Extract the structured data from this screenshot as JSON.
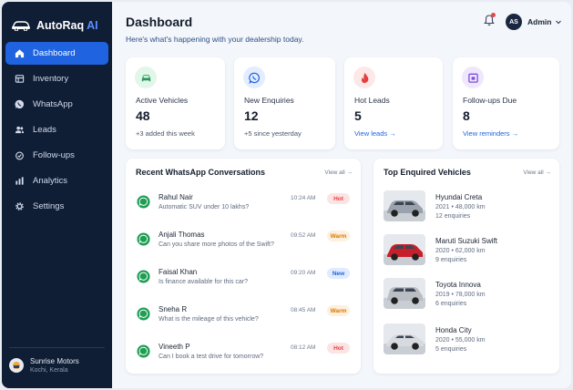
{
  "app": {
    "brand_prefix": "AutoRaq",
    "brand_suffix": "AI"
  },
  "sidebar": {
    "items": [
      {
        "label": "Dashboard",
        "icon": "home-icon",
        "active": true
      },
      {
        "label": "Inventory",
        "icon": "inventory-icon",
        "active": false
      },
      {
        "label": "WhatsApp",
        "icon": "whatsapp-icon",
        "active": false
      },
      {
        "label": "Leads",
        "icon": "users-icon",
        "active": false
      },
      {
        "label": "Follow-ups",
        "icon": "followup-icon",
        "active": false
      },
      {
        "label": "Analytics",
        "icon": "analytics-icon",
        "active": false
      },
      {
        "label": "Settings",
        "icon": "gear-icon",
        "active": false
      }
    ],
    "dealer": {
      "name": "Sunrise Motors",
      "location": "Kochi, Kerala"
    }
  },
  "header": {
    "title": "Dashboard",
    "subtitle": "Here's what's happening with your dealership today.",
    "user_initials": "AS",
    "user_name": "Admin"
  },
  "stats": [
    {
      "label": "Active Vehicles",
      "value": "48",
      "sub": "+3 added this week",
      "icon": "car-icon",
      "color": "#1f9d55",
      "bg": "#e3f6ea"
    },
    {
      "label": "New Enquiries",
      "value": "12",
      "sub": "+5 since yesterday",
      "icon": "whatsapp-icon",
      "color": "#1f63e0",
      "bg": "#e3edff"
    },
    {
      "label": "Hot Leads",
      "value": "5",
      "link": "View leads →",
      "icon": "flame-icon",
      "color": "#e53e3e",
      "bg": "#fde8e8"
    },
    {
      "label": "Follow-ups Due",
      "value": "8",
      "link": "View reminders →",
      "icon": "calendar-icon",
      "color": "#7c4ddb",
      "bg": "#efe7fc"
    }
  ],
  "conversations": {
    "title": "Recent WhatsApp Conversations",
    "view_all": "View all →",
    "items": [
      {
        "name": "Rahul Nair",
        "message": "Automatic SUV under 10 lakhs?",
        "time": "10:24 AM",
        "badge": "Hot",
        "badge_color": "#e53e3e",
        "badge_bg": "#fde4e4"
      },
      {
        "name": "Anjali Thomas",
        "message": "Can you share more photos of the Swift?",
        "time": "09:52 AM",
        "badge": "Warm",
        "badge_color": "#d97706",
        "badge_bg": "#fdf0dc"
      },
      {
        "name": "Faisal Khan",
        "message": "Is finance available for this car?",
        "time": "09:20 AM",
        "badge": "New",
        "badge_color": "#1f63e0",
        "badge_bg": "#e0ebff"
      },
      {
        "name": "Sneha R",
        "message": "What is the mileage of this vehicle?",
        "time": "08:45 AM",
        "badge": "Warm",
        "badge_color": "#d97706",
        "badge_bg": "#fdf0dc"
      },
      {
        "name": "Vineeth P",
        "message": "Can I book a test drive for tomorrow?",
        "time": "08:12 AM",
        "badge": "Hot",
        "badge_color": "#e53e3e",
        "badge_bg": "#fde4e4"
      }
    ]
  },
  "vehicles": {
    "title": "Top Enquired Vehicles",
    "view_all": "View all →",
    "items": [
      {
        "name": "Hyundai Creta",
        "meta": "2021 • 48,000 km",
        "enquiries": "12 enquiries",
        "color": "#9aa3ad"
      },
      {
        "name": "Maruti Suzuki Swift",
        "meta": "2020 • 62,000 km",
        "enquiries": "9 enquiries",
        "color": "#c8202a"
      },
      {
        "name": "Toyota Innova",
        "meta": "2019 • 78,000 km",
        "enquiries": "6 enquiries",
        "color": "#b9bec5"
      },
      {
        "name": "Honda City",
        "meta": "2020 • 55,000 km",
        "enquiries": "5 enquiries",
        "color": "#d7dade"
      }
    ]
  }
}
